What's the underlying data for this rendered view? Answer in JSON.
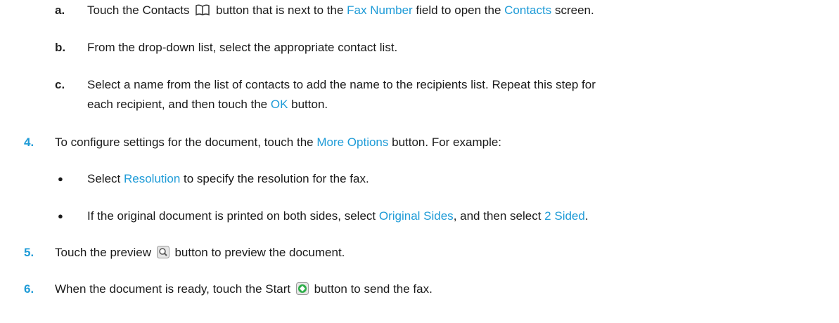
{
  "steps": {
    "a": {
      "marker": "a.",
      "t1": "Touch the Contacts ",
      "t2": " button that is next to the ",
      "link1": "Fax Number",
      "t3": " field to open the ",
      "link2": "Contacts",
      "t4": " screen."
    },
    "b": {
      "marker": "b.",
      "text": "From the drop-down list, select the appropriate contact list."
    },
    "c": {
      "marker": "c.",
      "line1": "Select a name from the list of contacts to add the name to the recipients list. Repeat this step for",
      "t1": "each recipient, and then touch the ",
      "link": "OK",
      "t2": " button."
    },
    "s4": {
      "marker": "4.",
      "t1": "To configure settings for the document, touch the ",
      "link": "More Options",
      "t2": " button. For example:",
      "bullet1": {
        "t1": "Select ",
        "link": "Resolution",
        "t2": " to specify the resolution for the fax."
      },
      "bullet2": {
        "t1": "If the original document is printed on both sides, select ",
        "link1": "Original Sides",
        "t2": ", and then select ",
        "link2": "2 Sided",
        "t3": "."
      }
    },
    "s5": {
      "marker": "5.",
      "t1": "Touch the preview ",
      "t2": " button to preview the document."
    },
    "s6": {
      "marker": "6.",
      "t1": "When the document is ready, touch the Start ",
      "t2": " button to send the fax."
    }
  },
  "icons": {
    "contacts": "book-icon",
    "preview": "magnifier-icon",
    "start": "start-icon"
  },
  "colors": {
    "link": "#1e9bd7",
    "start_green": "#2fae4a"
  }
}
